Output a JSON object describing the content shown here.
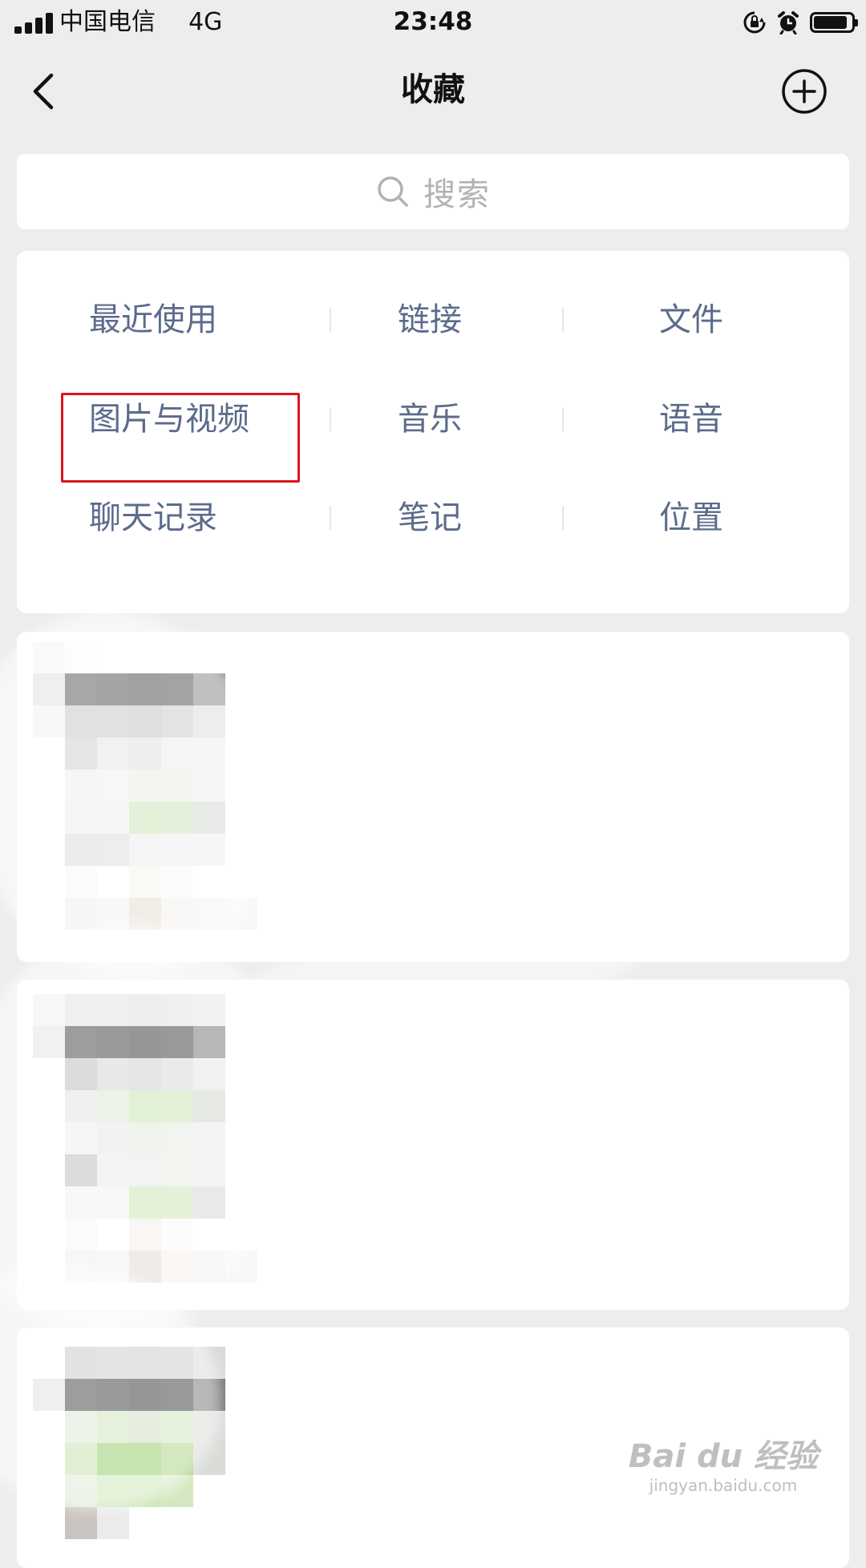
{
  "status_bar": {
    "carrier": "中国电信",
    "network": "4G",
    "time": "23:48",
    "battery_level": 0.9
  },
  "header": {
    "title": "收藏"
  },
  "search": {
    "placeholder": "搜索"
  },
  "categories": {
    "row1": [
      "最近使用",
      "链接",
      "文件"
    ],
    "row2": [
      "图片与视频",
      "音乐",
      "语音"
    ],
    "row3": [
      "聊天记录",
      "笔记",
      "位置"
    ],
    "highlighted": "图片与视频",
    "highlight_color": "#e0131f"
  },
  "colors": {
    "background": "#ededed",
    "card": "#ffffff",
    "category_text": "#5b6b8c",
    "placeholder": "#b2b2b2"
  },
  "icons": {
    "back": "chevron-left-icon",
    "add": "plus-circle-icon",
    "search": "search-icon",
    "rotation_lock": "rotation-lock-icon",
    "alarm": "alarm-icon",
    "battery": "battery-icon",
    "signal": "signal-icon"
  },
  "watermark": {
    "main": "Bai du 经验",
    "sub": "jingyan.baidu.com"
  }
}
